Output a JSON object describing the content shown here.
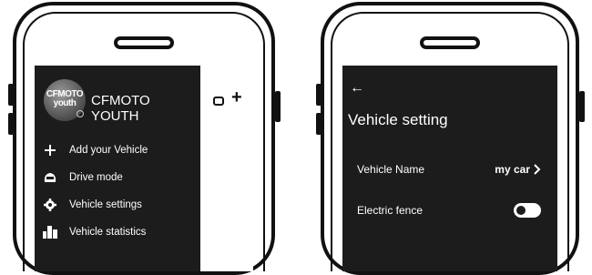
{
  "left_screen": {
    "avatar_text": "CFMOTO\nyouth",
    "brand_name": "CFMOTO YOUTH",
    "menu_items": [
      {
        "label": "Add your Vehicle",
        "icon": "plus-icon"
      },
      {
        "label": "Drive mode",
        "icon": "helmet-icon"
      },
      {
        "label": "Vehicle settings",
        "icon": "gear-icon"
      },
      {
        "label": "Vehicle statistics",
        "icon": "bar-chart-icon"
      }
    ],
    "header_plus": "+"
  },
  "right_screen": {
    "back_arrow": "←",
    "title": "Vehicle setting",
    "vehicle_name_label": "Vehicle Name",
    "vehicle_name_value": "my car",
    "electric_fence_label": "Electric fence",
    "electric_fence_on": true
  },
  "colors": {
    "screen_bg": "#1c1c1c",
    "frame": "#111111",
    "text": "#ffffff"
  }
}
